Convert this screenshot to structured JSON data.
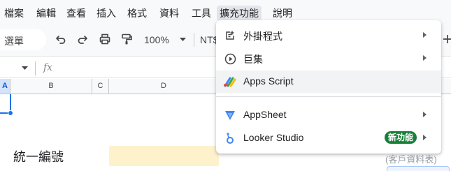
{
  "menubar": {
    "items": [
      {
        "label": "檔案"
      },
      {
        "label": "編輯"
      },
      {
        "label": "查看"
      },
      {
        "label": "插入"
      },
      {
        "label": "格式"
      },
      {
        "label": "資料"
      },
      {
        "label": "工具"
      },
      {
        "label": "擴充功能"
      },
      {
        "label": "說明"
      }
    ],
    "active_index": 7
  },
  "toolbar": {
    "search_label": "選單",
    "zoom": "100%",
    "currency": "NT$"
  },
  "formula_bar": {
    "fx_label": "fx"
  },
  "columns": {
    "headers": [
      "A",
      "B",
      "C",
      "D"
    ],
    "selected": "A"
  },
  "sheet": {
    "cell_text": "統一編號",
    "side_text": "(客戶資料表)"
  },
  "dropdown": {
    "items": [
      {
        "label": "外掛程式",
        "icon": "addons-icon",
        "has_submenu": true
      },
      {
        "label": "巨集",
        "icon": "macros-play-icon",
        "has_submenu": true
      },
      {
        "label": "Apps Script",
        "icon": "apps-script-icon",
        "has_submenu": false,
        "hovered": true
      },
      {
        "label": "AppSheet",
        "icon": "appsheet-icon",
        "has_submenu": true
      },
      {
        "label": "Looker Studio",
        "icon": "looker-studio-icon",
        "has_submenu": true,
        "badge": "新功能"
      }
    ]
  },
  "colors": {
    "accent": "#1a73e8",
    "selected_header_bg": "#d3e3fd",
    "new_badge": "#188038",
    "highlight_cell": "#fef2cd"
  }
}
